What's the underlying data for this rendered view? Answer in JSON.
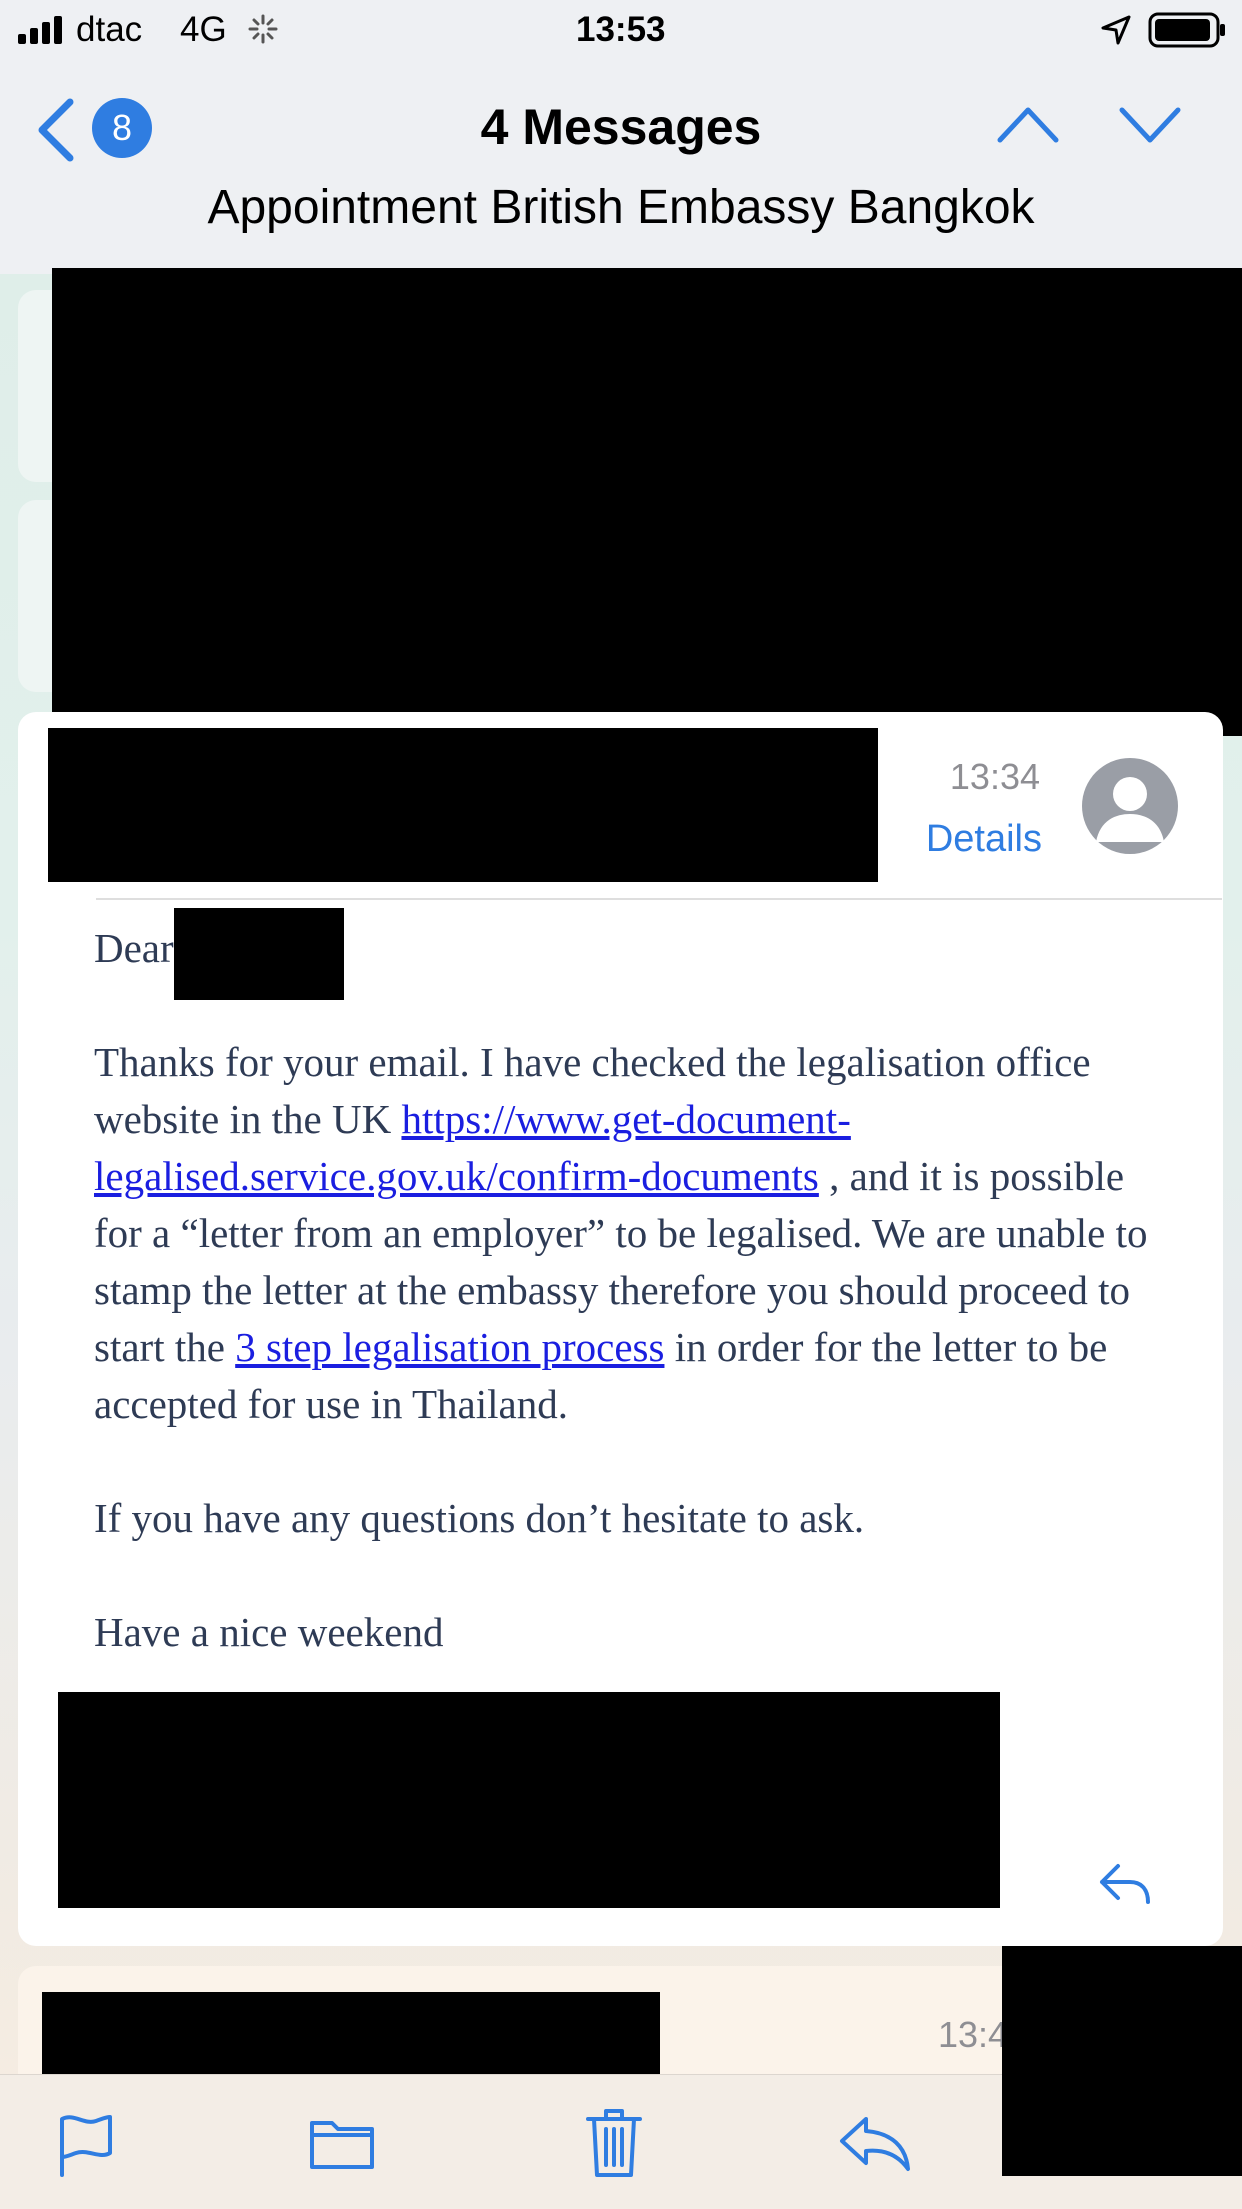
{
  "status_bar": {
    "carrier": "dtac",
    "network": "4G",
    "time": "13:53"
  },
  "nav": {
    "unread_badge": "8",
    "title": "4 Messages",
    "subject": "Appointment British Embassy Bangkok"
  },
  "message": {
    "time": "13:34",
    "details_label": "Details",
    "greeting": "Dear",
    "para1_a": "Thanks for your email.  I have checked the legalisation office website in the UK ",
    "link1": "https://www.get-document-legalised.service.gov.uk/confirm-documents",
    "para1_b": " , and it is possible for a “letter from an employer” to be legalised. We are unable to stamp the letter at the embassy therefore you should proceed to start the ",
    "link2": "3 step legalisation process",
    "para1_c": " in order for the letter to be accepted for use in Thailand.",
    "para2": "If you have any questions don’t hesitate to ask.",
    "para3": "Have a nice weekend"
  },
  "next_message": {
    "time_partial": "13:4"
  },
  "colors": {
    "accent": "#2f7de1",
    "body_text": "#2e3b55",
    "link": "#1a1ee0"
  },
  "icons": [
    "signal-icon",
    "loading-icon",
    "location-arrow-icon",
    "battery-icon",
    "back-chevron-icon",
    "previous-message-icon",
    "next-message-icon",
    "avatar-icon",
    "reply-icon",
    "flag-icon",
    "folder-icon",
    "trash-icon",
    "reply-toolbar-icon"
  ]
}
